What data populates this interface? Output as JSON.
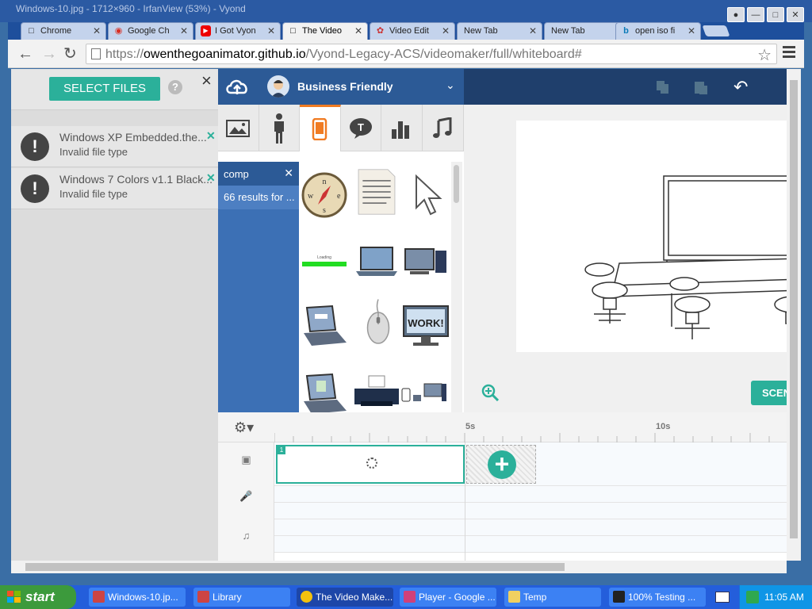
{
  "window": {
    "title": "Windows-10.jpg - 1712×960 - IrfanView (53%) - Vyond"
  },
  "tabs": [
    {
      "label": "Chrome",
      "icon": "page-icon"
    },
    {
      "label": "Google Ch",
      "icon": "chrome-icon"
    },
    {
      "label": "I Got Vyon",
      "icon": "youtube-icon"
    },
    {
      "label": "The Video",
      "icon": "page-icon",
      "active": true
    },
    {
      "label": "Video Edit",
      "icon": "vyond-icon"
    },
    {
      "label": "New Tab",
      "icon": "none"
    },
    {
      "label": "New Tab",
      "icon": "none"
    },
    {
      "label": "open iso fi",
      "icon": "bing-icon"
    }
  ],
  "address": {
    "prefix": "https://",
    "host": "owenthegoanimator.github.io",
    "path": "/Vyond-Legacy-ACS/videomaker/full/whiteboard#"
  },
  "upload": {
    "select_label": "SELECT FILES",
    "help": "?",
    "close": "×",
    "files": [
      {
        "name": "Windows XP Embedded.the...",
        "status": "Invalid file type"
      },
      {
        "name": "Windows 7 Colors v1.1 Black...",
        "status": "Invalid file type"
      }
    ]
  },
  "studio": {
    "theme_name": "Business Friendly",
    "search_term": "comp",
    "results_text": "66 results for ...",
    "scene_btn": "SCEN",
    "timeline_marks": [
      "5s",
      "10s"
    ],
    "scene_number": "1",
    "add_scene": "+"
  },
  "taskbar": {
    "start": "start",
    "tasks": [
      {
        "label": "Windows-10.jp...",
        "icon": "irfanview-icon"
      },
      {
        "label": "Library",
        "icon": "irfanview-icon"
      },
      {
        "label": "The Video Make...",
        "icon": "chrome-icon",
        "active": true
      },
      {
        "label": "Player - Google ...",
        "icon": "vyond-icon"
      },
      {
        "label": "Temp",
        "icon": "folder-icon"
      },
      {
        "label": "100% Testing ...",
        "icon": "7zip-icon"
      }
    ],
    "clock": "11:05 AM"
  },
  "colors": {
    "accent": "#2bb09a",
    "brand_blue": "#2c5a96",
    "preview_orange": "#f07b22"
  }
}
